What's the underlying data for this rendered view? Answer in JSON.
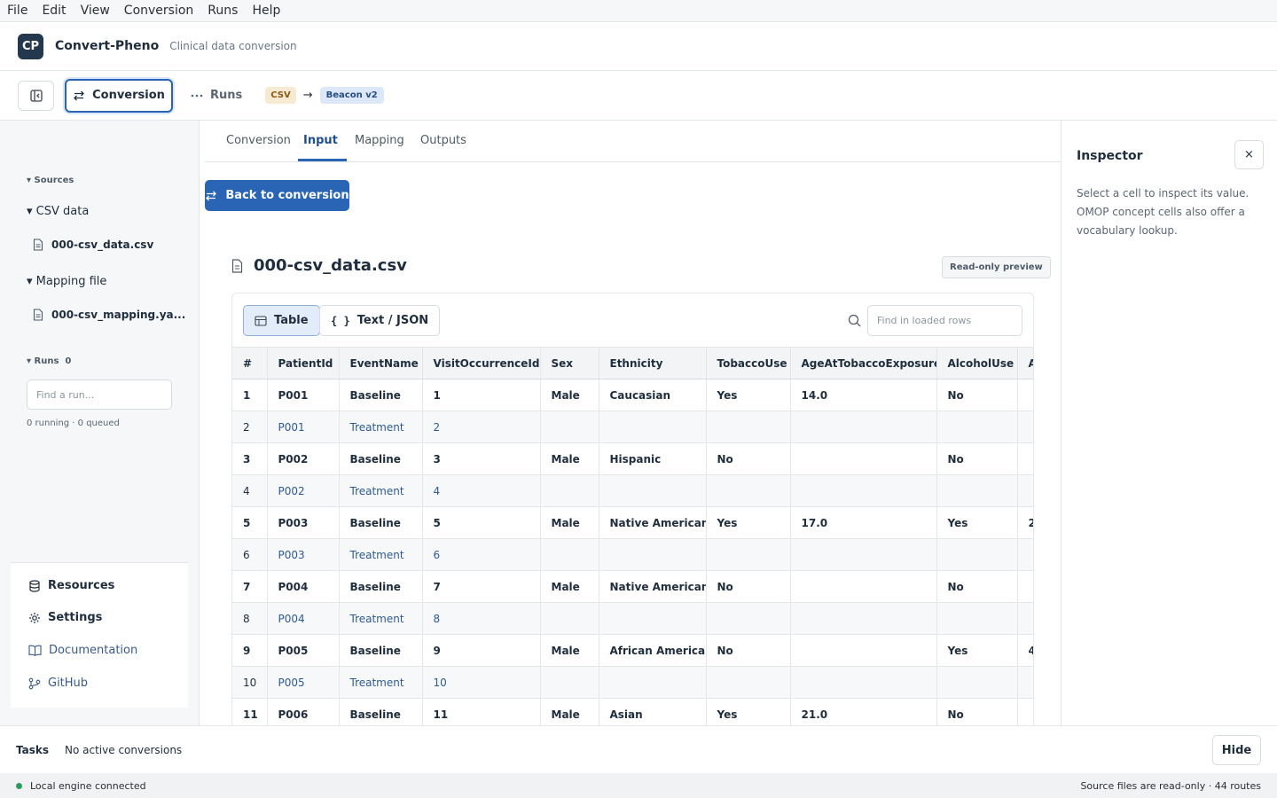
{
  "menu": [
    "File",
    "Edit",
    "View",
    "Conversion",
    "Runs",
    "Help"
  ],
  "app": {
    "logo": "CP",
    "name": "Convert-Pheno",
    "subtitle": "Clinical data conversion"
  },
  "toolbar": {
    "conversion_label": "Conversion",
    "runs_label": "Runs",
    "source_format": "CSV",
    "arrow": "→",
    "target_format": "Beacon v2"
  },
  "sidebar": {
    "sources_label": "Sources",
    "csv_group": "CSV data",
    "csv_file": "000-csv_data.csv",
    "mapping_group": "Mapping file",
    "mapping_file": "000-csv_mapping.ya...",
    "runs_label": "Runs",
    "runs_count": "0",
    "run_search_placeholder": "Find a run...",
    "run_status": "0 running · 0 queued",
    "links": {
      "resources": "Resources",
      "settings": "Settings",
      "documentation": "Documentation",
      "github": "GitHub"
    }
  },
  "tabs": [
    "Conversion",
    "Input",
    "Mapping",
    "Outputs"
  ],
  "main": {
    "back_button": "Back to conversion",
    "file_title": "000-csv_data.csv",
    "readonly_badge": "Read-only preview",
    "view_table": "Table",
    "view_text": "Text / JSON",
    "find_placeholder": "Find in loaded rows"
  },
  "table": {
    "columns": [
      "#",
      "PatientId",
      "EventName",
      "VisitOccurrenceId",
      "Sex",
      "Ethnicity",
      "TobaccoUse",
      "AgeAtTobaccoExposure",
      "AlcoholUse",
      "A"
    ],
    "rows": [
      [
        "1",
        "P001",
        "Baseline",
        "1",
        "Male",
        "Caucasian",
        "Yes",
        "14.0",
        "No",
        ""
      ],
      [
        "2",
        "P001",
        "Treatment",
        "2",
        "",
        "",
        "",
        "",
        "",
        ""
      ],
      [
        "3",
        "P002",
        "Baseline",
        "3",
        "Male",
        "Hispanic",
        "No",
        "",
        "No",
        ""
      ],
      [
        "4",
        "P002",
        "Treatment",
        "4",
        "",
        "",
        "",
        "",
        "",
        ""
      ],
      [
        "5",
        "P003",
        "Baseline",
        "5",
        "Male",
        "Native American",
        "Yes",
        "17.0",
        "Yes",
        "2"
      ],
      [
        "6",
        "P003",
        "Treatment",
        "6",
        "",
        "",
        "",
        "",
        "",
        ""
      ],
      [
        "7",
        "P004",
        "Baseline",
        "7",
        "Male",
        "Native American",
        "No",
        "",
        "No",
        ""
      ],
      [
        "8",
        "P004",
        "Treatment",
        "8",
        "",
        "",
        "",
        "",
        "",
        ""
      ],
      [
        "9",
        "P005",
        "Baseline",
        "9",
        "Male",
        "African American",
        "No",
        "",
        "Yes",
        "4"
      ],
      [
        "10",
        "P005",
        "Treatment",
        "10",
        "",
        "",
        "",
        "",
        "",
        ""
      ],
      [
        "11",
        "P006",
        "Baseline",
        "11",
        "Male",
        "Asian",
        "Yes",
        "21.0",
        "No",
        ""
      ]
    ]
  },
  "inspector": {
    "title": "Inspector",
    "close": "×",
    "description": "Select a cell to inspect its value. OMOP concept cells also offer a vocabulary lookup."
  },
  "tasks": {
    "label": "Tasks",
    "status": "No active conversions",
    "hide_button": "Hide"
  },
  "statusbar": {
    "engine": "Local engine connected",
    "right": "Source files are read-only · 44 routes"
  },
  "colors": {
    "accent": "#2a64b5",
    "engine_ok": "#2f9a5e",
    "logo_bg": "#23384c"
  },
  "icons": [
    "sidebar-toggle-icon",
    "swap-icon",
    "dots-icon",
    "file-icon",
    "database-icon",
    "gear-icon",
    "book-icon",
    "git-branch-icon",
    "table-icon",
    "braces-icon",
    "search-icon"
  ]
}
